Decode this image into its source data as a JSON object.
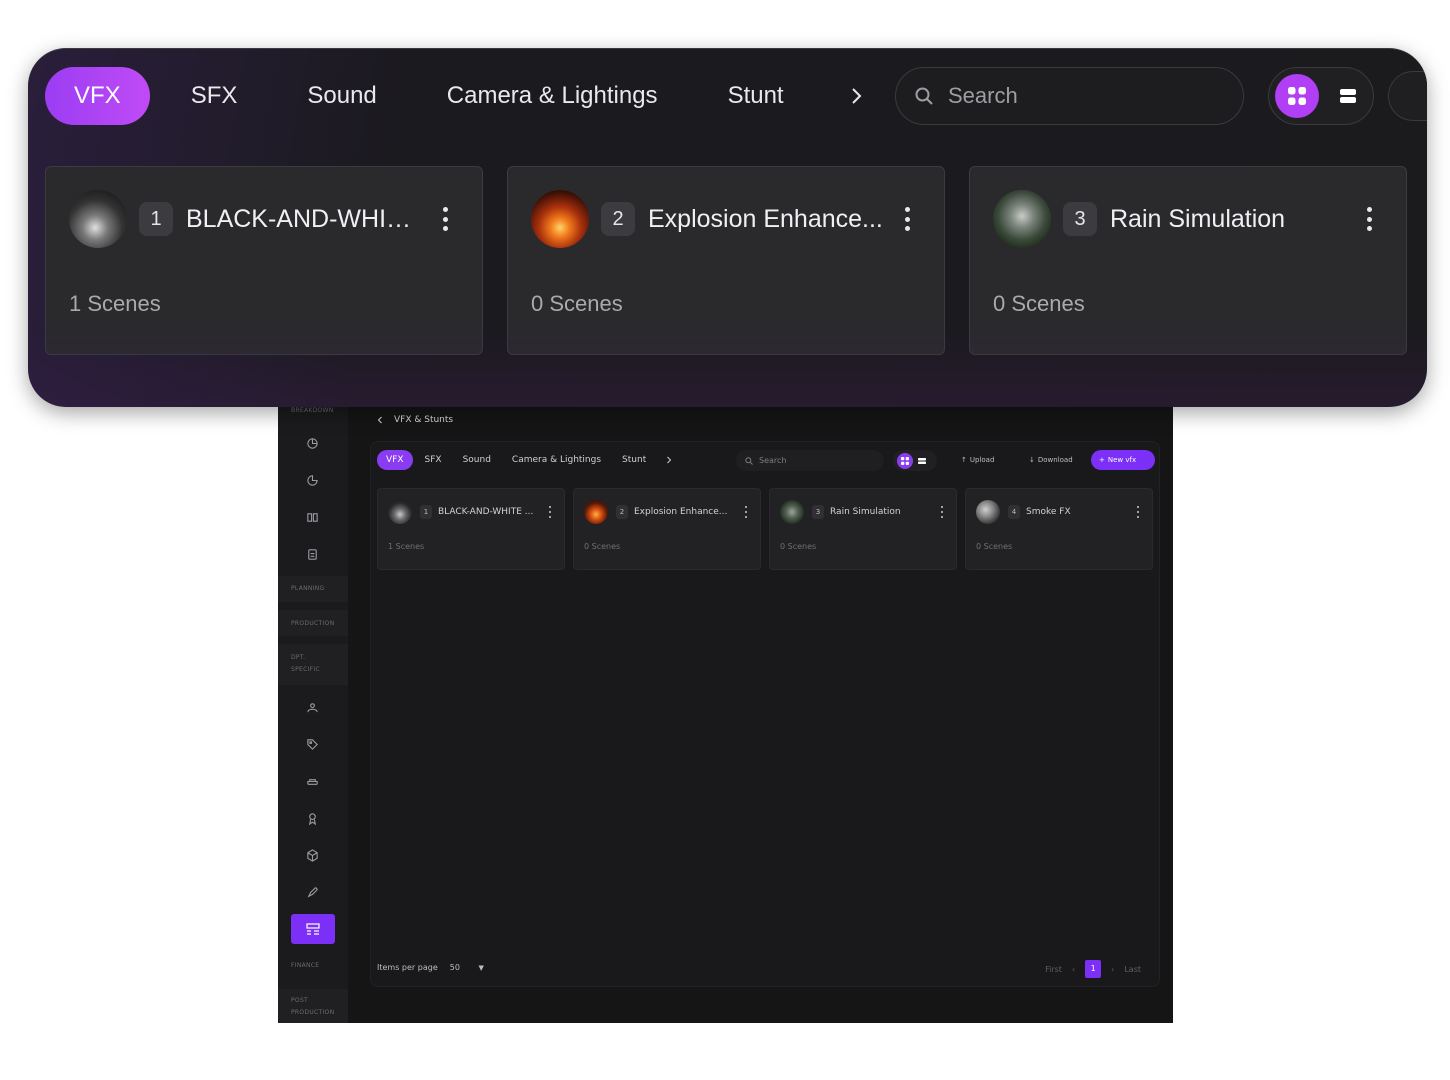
{
  "zoom": {
    "tabs": [
      "VFX",
      "SFX",
      "Sound",
      "Camera & Lightings",
      "Stunt"
    ],
    "active_tab": "VFX",
    "search_placeholder": "Search",
    "cards": [
      {
        "num": "1",
        "title": "BLACK-AND-WHITE ...",
        "scenes": "1 Scenes"
      },
      {
        "num": "2",
        "title": "Explosion Enhance...",
        "scenes": "0 Scenes"
      },
      {
        "num": "3",
        "title": "Rain Simulation",
        "scenes": "0 Scenes"
      }
    ]
  },
  "app": {
    "sidebar": {
      "sections": [
        "BREAKDOWN",
        "PLANNING",
        "PRODUCTION",
        "DPT. SPECIFIC",
        "FINANCE",
        "POST PRODUCTION"
      ]
    },
    "breadcrumb": "VFX & Stunts",
    "tabs": [
      "VFX",
      "SFX",
      "Sound",
      "Camera & Lightings",
      "Stunt"
    ],
    "search_placeholder": "Search",
    "upload_label": "Upload",
    "download_label": "Download",
    "new_label": "New vfx",
    "cards": [
      {
        "num": "1",
        "title": "BLACK-AND-WHITE ...",
        "scenes": "1 Scenes"
      },
      {
        "num": "2",
        "title": "Explosion Enhance...",
        "scenes": "0 Scenes"
      },
      {
        "num": "3",
        "title": "Rain Simulation",
        "scenes": "0 Scenes"
      },
      {
        "num": "4",
        "title": "Smoke FX",
        "scenes": "0 Scenes"
      }
    ],
    "footer": {
      "items_per_page_label": "Items per page",
      "items_per_page_value": "50",
      "first": "First",
      "page": "1",
      "last": "Last"
    }
  },
  "colors": {
    "accent": "#8a3cf2",
    "accent_gradient_end": "#c04bf5",
    "background": "#151516"
  }
}
